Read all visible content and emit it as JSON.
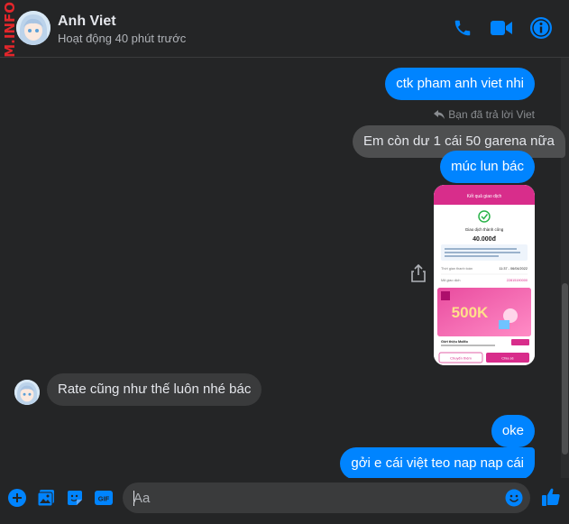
{
  "header": {
    "watermark": "M.INFO",
    "contact_name": "Anh Viet",
    "status": "Hoạt động 40 phút trước",
    "icons": [
      "phone-icon",
      "video-call-icon",
      "info-icon"
    ]
  },
  "messages": [
    {
      "side": "out",
      "text": "ctk pham anh viet nhi"
    },
    {
      "side": "note",
      "text": "Bạn đã trả lời Viet"
    },
    {
      "side": "in",
      "text": "Em còn dư 1 cái 50 garena nữa"
    },
    {
      "side": "out",
      "text": "múc lun bác"
    },
    {
      "side": "out-image",
      "description": "transaction-screenshot"
    },
    {
      "side": "in",
      "text": "Rate cũng như thế luôn nhé bác"
    },
    {
      "side": "out",
      "text": "oke"
    },
    {
      "side": "out",
      "text": "gởi e cái việt teo nap nap cái"
    }
  ],
  "receipt": {
    "title": "Kết quả giao dịch",
    "status": "Giao dịch thành công",
    "amount": "40.000đ",
    "time_label": "Thời gian thanh toán",
    "time_value": "11:37 - 06/04/2022",
    "code_label": "Mã giao dịch",
    "code_value": "22815190000",
    "promo": "500K",
    "promo_title": "Giới thiệu MoMo",
    "btn_left": "Chuyển thêm",
    "btn_right": "Chia sẻ"
  },
  "composer": {
    "placeholder": "Aa",
    "icons": [
      "add-icon",
      "photo-icon",
      "sticker-icon",
      "gif-icon",
      "emoji-icon",
      "like-icon"
    ],
    "gif_label": "GIF"
  },
  "colors": {
    "accent": "#0084ff",
    "background": "#242526",
    "bubble_in": "#3a3b3c",
    "watermark": "#e2262b"
  }
}
